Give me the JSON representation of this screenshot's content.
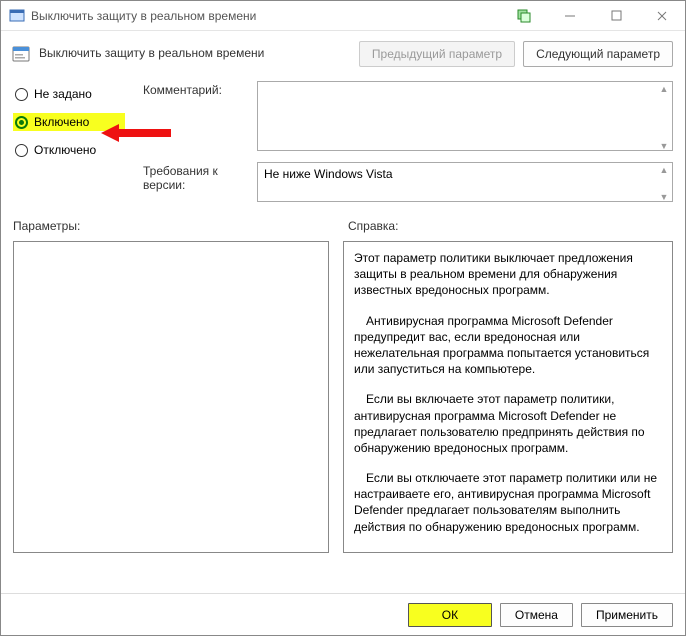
{
  "titlebar": {
    "title": "Выключить защиту в реальном времени"
  },
  "header": {
    "title": "Выключить защиту в реальном времени",
    "prev_btn": "Предыдущий параметр",
    "next_btn": "Следующий параметр"
  },
  "radios": {
    "not_configured": "Не задано",
    "enabled": "Включено",
    "disabled": "Отключено",
    "selected": "enabled"
  },
  "fields": {
    "comment_label": "Комментарий:",
    "comment_value": "",
    "requirements_label": "Требования к версии:",
    "requirements_value": "Не ниже Windows Vista"
  },
  "panels": {
    "params_label": "Параметры:",
    "help_label": "Справка:",
    "help_paragraphs": [
      "Этот параметр политики выключает предложения защиты в реальном времени для обнаружения известных вредоносных программ.",
      "Антивирусная программа Microsoft Defender предупредит вас, если вредоносная или нежелательная программа попытается установиться или запуститься на компьютере.",
      "Если вы включаете этот параметр политики, антивирусная программа Microsoft Defender не предлагает пользователю предпринять действия по обнаружению вредоносных программ.",
      "Если вы отключаете этот параметр политики или не настраиваете его, антивирусная программа Microsoft Defender предлагает пользователям выполнить действия по обнаружению вредоносных программ."
    ]
  },
  "footer": {
    "ok": "ОК",
    "cancel": "Отмена",
    "apply": "Применить"
  }
}
